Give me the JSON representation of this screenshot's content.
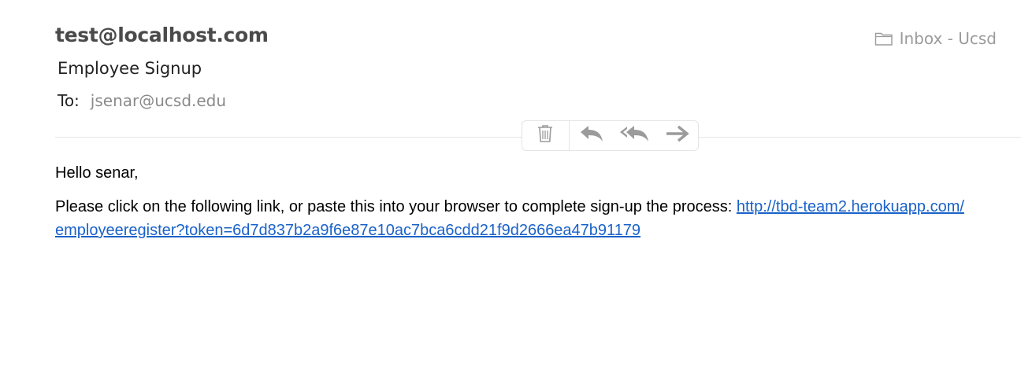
{
  "header": {
    "sender": "test@localhost.com",
    "subject": "Employee Signup",
    "to_label": "To:",
    "to_value": "jsenar@ucsd.edu",
    "mailbox": "Inbox - Ucsd"
  },
  "toolbar": {
    "icons": [
      "trash-icon",
      "reply-icon",
      "reply-all-icon",
      "forward-icon"
    ]
  },
  "message": {
    "greeting": "Hello senar,",
    "body_text": "Please click on the following link, or paste this into your browser to complete sign-up the process: ",
    "link": "http://tbd-team2.herokuapp.com/employeeregister?token=6d7d837b2a9f6e87e10ac7bca6cdd21f9d2666ea47b91179"
  },
  "colors": {
    "link": "#1a62c9",
    "muted": "#9b9b9b",
    "sender": "#4a4a4a"
  }
}
